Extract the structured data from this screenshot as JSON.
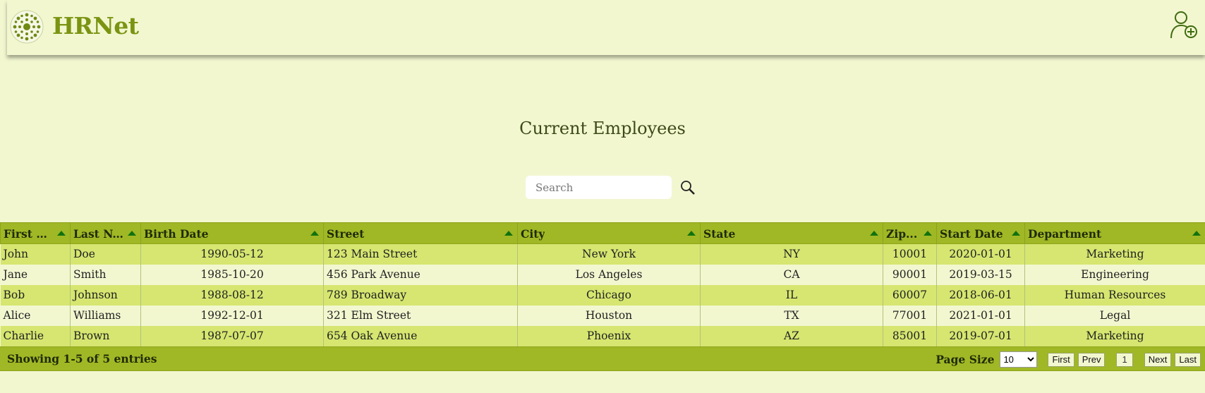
{
  "header": {
    "brand": "HRNet",
    "logo_icon": "flower-logo-icon",
    "add_user_icon": "add-user-icon"
  },
  "page": {
    "title": "Current Employees"
  },
  "search": {
    "placeholder": "Search",
    "value": ""
  },
  "table": {
    "columns": [
      "First N...",
      "Last N...",
      "Birth Date",
      "Street",
      "City",
      "State",
      "Zip...",
      "Start Date",
      "Department"
    ],
    "rows": [
      [
        "John",
        "Doe",
        "1990-05-12",
        "123 Main Street",
        "New York",
        "NY",
        "10001",
        "2020-01-01",
        "Marketing"
      ],
      [
        "Jane",
        "Smith",
        "1985-10-20",
        "456 Park Avenue",
        "Los Angeles",
        "CA",
        "90001",
        "2019-03-15",
        "Engineering"
      ],
      [
        "Bob",
        "Johnson",
        "1988-08-12",
        "789 Broadway",
        "Chicago",
        "IL",
        "60007",
        "2018-06-01",
        "Human Resources"
      ],
      [
        "Alice",
        "Williams",
        "1992-12-01",
        "321 Elm Street",
        "Houston",
        "TX",
        "77001",
        "2021-01-01",
        "Legal"
      ],
      [
        "Charlie",
        "Brown",
        "1987-07-07",
        "654 Oak Avenue",
        "Phoenix",
        "AZ",
        "85001",
        "2019-07-01",
        "Marketing"
      ]
    ]
  },
  "footer": {
    "showing": "Showing 1-5 of 5 entries",
    "page_size_label": "Page Size",
    "page_size_value": "10",
    "first": "First",
    "prev": "Prev",
    "current": "1",
    "next": "Next",
    "last": "Last"
  },
  "colors": {
    "accent": "#a0b825",
    "brand": "#7a9412",
    "background": "#f2f7d0",
    "row_odd": "#d6e670",
    "sort_arrow": "#11720f"
  }
}
